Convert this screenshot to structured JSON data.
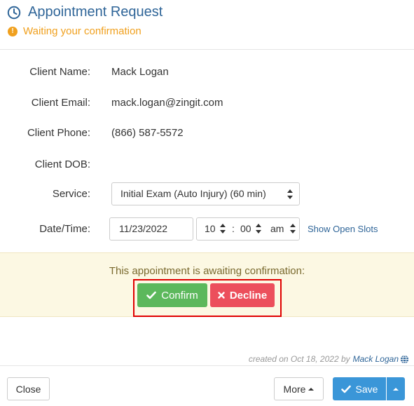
{
  "header": {
    "title": "Appointment Request",
    "status": "Waiting your confirmation"
  },
  "form": {
    "client_name": {
      "label": "Client Name:",
      "value": "Mack Logan"
    },
    "client_email": {
      "label": "Client Email:",
      "value": "mack.logan@zingit.com"
    },
    "client_phone": {
      "label": "Client Phone:",
      "value": "(866) 587-5572"
    },
    "client_dob": {
      "label": "Client DOB:",
      "value": ""
    },
    "service": {
      "label": "Service:",
      "selected": "Initial Exam (Auto Injury) (60 min)"
    },
    "datetime": {
      "label": "Date/Time:",
      "date": "11/23/2022",
      "hour": "10",
      "minute": "00",
      "separator": ":",
      "ampm": "am",
      "show_slots_link": "Show Open Slots"
    }
  },
  "banner": {
    "message": "This appointment is awaiting confirmation:",
    "confirm_label": "Confirm",
    "decline_label": "Decline"
  },
  "meta": {
    "created_prefix": "created on Oct 18, 2022 by",
    "created_by": "Mack Logan"
  },
  "footer": {
    "close_label": "Close",
    "more_label": "More",
    "save_label": "Save"
  },
  "colors": {
    "title": "#2f6598",
    "warning": "#f0a01e",
    "confirm": "#5cb85c",
    "decline": "#ec4f5c",
    "save": "#3a96d8",
    "banner_bg": "#fcf8e3",
    "highlight": "#e00000"
  }
}
